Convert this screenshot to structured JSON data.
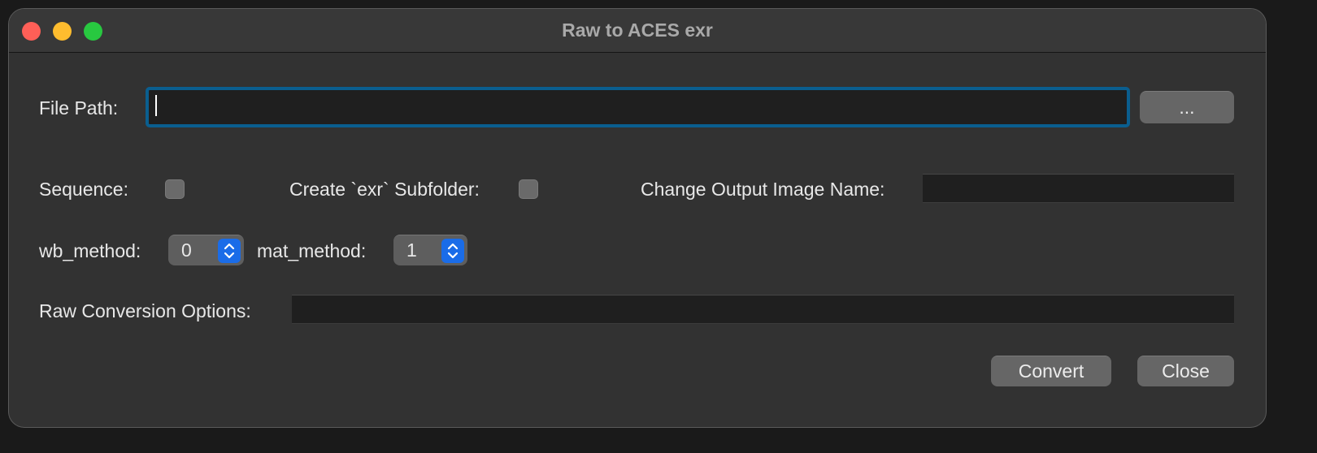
{
  "window": {
    "title": "Raw to ACES exr"
  },
  "file_path": {
    "label": "File Path:",
    "value": "",
    "browse_label": "..."
  },
  "options": {
    "sequence_label": "Sequence:",
    "sequence_checked": false,
    "subfolder_label": "Create `exr` Subfolder:",
    "subfolder_checked": false,
    "output_name_label": "Change Output Image Name:",
    "output_name_value": ""
  },
  "methods": {
    "wb_label": "wb_method:",
    "wb_value": "0",
    "mat_label": "mat_method:",
    "mat_value": "1"
  },
  "raw_options": {
    "label": "Raw Conversion Options:",
    "value": ""
  },
  "actions": {
    "convert_label": "Convert",
    "close_label": "Close"
  },
  "colors": {
    "focus_ring": "#0a5e8f",
    "stepper_accent": "#1a6ce8",
    "traffic_close": "#ff5f57",
    "traffic_minimize": "#febc2e",
    "traffic_zoom": "#28c840"
  }
}
